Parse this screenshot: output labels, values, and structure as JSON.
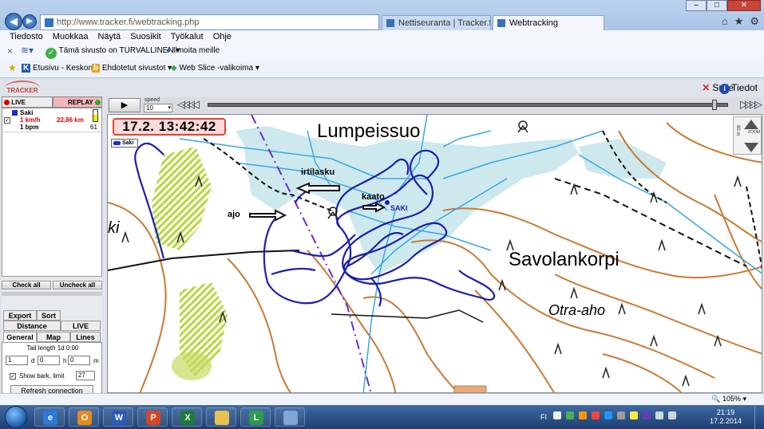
{
  "browser": {
    "url": "http://www.tracker.fi/webtracking.php",
    "tabs": [
      {
        "label": "Nettiseuranta | Tracker.fi"
      },
      {
        "label": "Webtracking"
      }
    ],
    "menu": [
      "Tiedosto",
      "Muokkaa",
      "Näytä",
      "Suosikit",
      "Työkalut",
      "Ohje"
    ],
    "security_text": "Tämä sivusto on TURVALLINEN",
    "report_text": "Ilmoita meille",
    "favorites": [
      "Etusivu - Keskonet",
      "Ehdotetut sivustot",
      "Web Slice -valikoima"
    ],
    "zoom_level": "105%"
  },
  "app": {
    "logo": "TRACKER",
    "close_label": "Sulje",
    "info_label": "Tiedot",
    "live_label": "LIVE",
    "replay_label": "REPLAY",
    "tracker": {
      "name": "Saki",
      "speed": "1 km/h",
      "bpm": "1 bpm",
      "distance": "22,86 km",
      "battery": "61",
      "battery_level": 0.6
    },
    "check_all": "Check all",
    "uncheck_all": "Uncheck all",
    "settings_tabs": [
      "Export",
      "Sort",
      "Distance",
      "LIVE",
      "General",
      "Map",
      "Lines"
    ],
    "tail_length_label": "Tail length 1d 0:00",
    "tail_days": "1",
    "tail_hours": "0",
    "tail_minutes": "0",
    "unit_d": "d",
    "unit_h": "h",
    "unit_m": "m",
    "show_bark_label": "Show bark, limit",
    "bark_limit": "27",
    "refresh_label": "Refresh connection",
    "player": {
      "play_symbol": "▶",
      "speed_label": "speed",
      "speed_value": "10",
      "rewind_symbol": "◁◁◁◁",
      "ffwd_symbol": "▷▷▷▷",
      "position_fraction": 0.98
    },
    "map": {
      "timestamp": "17.2. 13:42:42",
      "legend_name": "Saki",
      "place_names": [
        "Lumpeissuo",
        "Savolankorpi",
        "Otra-aho",
        "ki"
      ],
      "annotations": [
        "irtilasku",
        "kaato",
        "ajo"
      ],
      "dog_label": "SAKI",
      "scale_label": "80 m",
      "zoom_label": "ZOOM"
    }
  },
  "taskbar": {
    "language": "FI",
    "time": "21:19",
    "date": "17.2.2014"
  },
  "colors": {
    "track": "#1c1fa8",
    "swamp": "#cde9ee",
    "contour": "#c97a33",
    "stream": "#39a8e0",
    "marsh_green": "#b5d83c"
  }
}
